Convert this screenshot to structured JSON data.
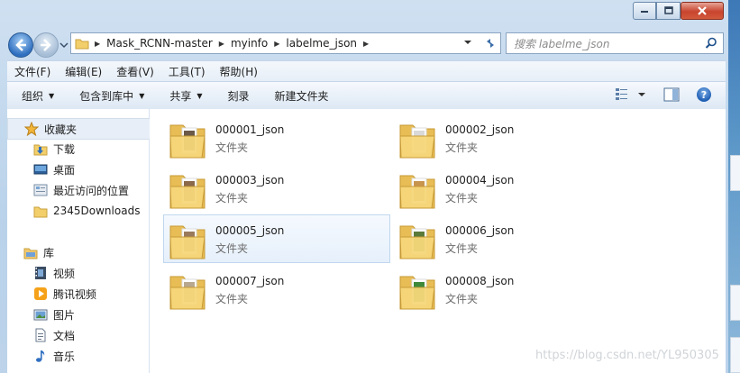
{
  "window": {
    "caption_buttons": [
      "minimize",
      "maximize",
      "close"
    ]
  },
  "address_bar": {
    "segments": [
      "Mask_RCNN-master",
      "myinfo",
      "labelme_json"
    ]
  },
  "search": {
    "placeholder": "搜索 labelme_json"
  },
  "menu": [
    "文件(F)",
    "编辑(E)",
    "查看(V)",
    "工具(T)",
    "帮助(H)"
  ],
  "commands": [
    {
      "label": "组织",
      "dropdown": true
    },
    {
      "label": "包含到库中",
      "dropdown": true
    },
    {
      "label": "共享",
      "dropdown": true
    },
    {
      "label": "刻录",
      "dropdown": false
    },
    {
      "label": "新建文件夹",
      "dropdown": false
    }
  ],
  "nav_pane": {
    "favorites": {
      "label": "收藏夹",
      "icon": "star-icon"
    },
    "favorite_items": [
      {
        "label": "下载",
        "icon": "download-folder-icon"
      },
      {
        "label": "桌面",
        "icon": "desktop-icon"
      },
      {
        "label": "最近访问的位置",
        "icon": "recent-places-icon"
      },
      {
        "label": "2345Downloads",
        "icon": "folder-icon"
      }
    ],
    "libraries": {
      "label": "库",
      "icon": "library-icon"
    },
    "library_items": [
      {
        "label": "视频",
        "icon": "video-icon"
      },
      {
        "label": "腾讯视频",
        "icon": "tencent-video-icon"
      },
      {
        "label": "图片",
        "icon": "pictures-icon"
      },
      {
        "label": "文档",
        "icon": "documents-icon"
      },
      {
        "label": "音乐",
        "icon": "music-icon"
      }
    ]
  },
  "files": [
    {
      "name": "000001_json",
      "type": "文件夹",
      "selected": false,
      "thumb": "#6b5a48"
    },
    {
      "name": "000002_json",
      "type": "文件夹",
      "selected": false,
      "thumb": "#d9d9d9"
    },
    {
      "name": "000003_json",
      "type": "文件夹",
      "selected": false,
      "thumb": "#8a6a4a"
    },
    {
      "name": "000004_json",
      "type": "文件夹",
      "selected": false,
      "thumb": "#c8954e"
    },
    {
      "name": "000005_json",
      "type": "文件夹",
      "selected": true,
      "thumb": "#9a7a5c"
    },
    {
      "name": "000006_json",
      "type": "文件夹",
      "selected": false,
      "thumb": "#5a7a3a"
    },
    {
      "name": "000007_json",
      "type": "文件夹",
      "selected": false,
      "thumb": "#b8a890"
    },
    {
      "name": "000008_json",
      "type": "文件夹",
      "selected": false,
      "thumb": "#3f8a3a"
    }
  ],
  "watermark": "https://blog.csdn.net/YL950305",
  "colors": {
    "accent": "#2f6fc0",
    "selection": "#e6f0fb",
    "folder": "#f3cf6b"
  }
}
